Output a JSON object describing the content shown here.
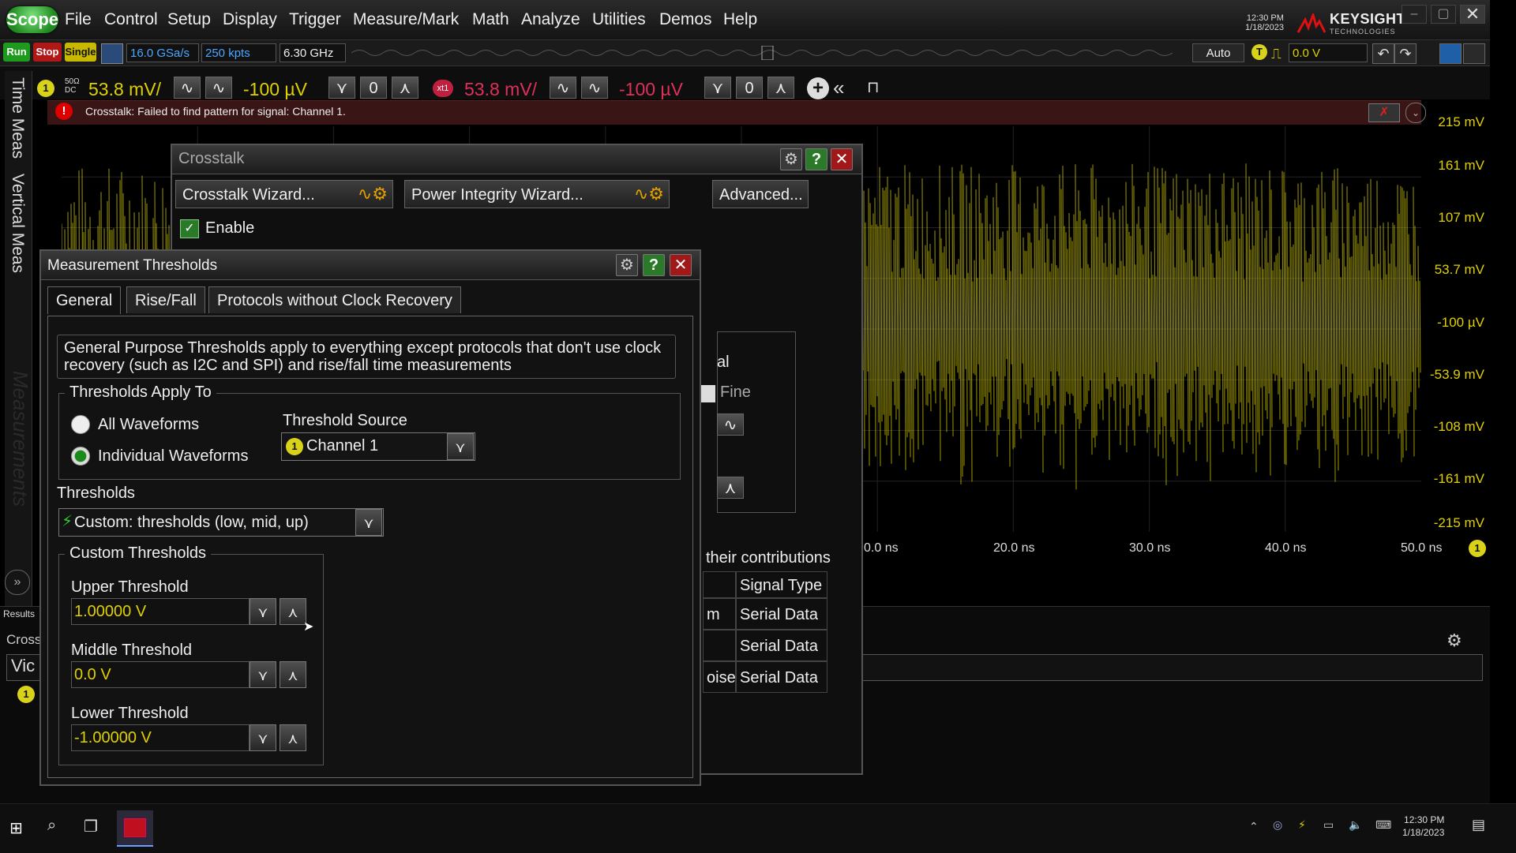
{
  "menubar": {
    "scope_label": "Scope",
    "items": [
      "File",
      "Control",
      "Setup",
      "Display",
      "Trigger",
      "Measure/Mark",
      "Math",
      "Analyze",
      "Utilities",
      "Demos",
      "Help"
    ],
    "clock_time": "12:30 PM",
    "clock_date": "1/18/2023",
    "brand": "KEYSIGHT",
    "brand_sub": "TECHNOLOGIES"
  },
  "toolbar": {
    "run": "Run",
    "stop": "Stop",
    "single": "Single",
    "sample_rate": "16.0 GSa/s",
    "memory": "250 kpts",
    "bandwidth": "6.30 GHz",
    "trigger_mode": "Auto",
    "trigger_badge": "T",
    "trigger_level": "0.0 V"
  },
  "channels": {
    "ch1_badge": "1",
    "ch1_coupling_top": "50Ω",
    "ch1_coupling_bottom": "DC",
    "ch1_scale": "53.8 mV/",
    "ch1_offset": "-100 µV",
    "x1_badge": "xt1",
    "x1_scale": "53.8 mV/",
    "x1_offset": "-100 µV"
  },
  "alert": {
    "message": "Crosstalk: Failed to find pattern for signal: Channel 1."
  },
  "sidetabs": {
    "time_meas": "Time Meas",
    "vertical_meas": "Vertical Meas",
    "measurements": "Measurements"
  },
  "waveform": {
    "y_labels": [
      "215 mV",
      "161 mV",
      "107 mV",
      "53.7 mV",
      "-100 µV",
      "-53.9 mV",
      "-108 mV",
      "-161 mV",
      "-215 mV"
    ],
    "x_labels": [
      "0.0 ns",
      "20.0 ns",
      "30.0 ns",
      "40.0 ns",
      "50.0 ns"
    ],
    "channel_marker": "1",
    "color": "#d4cc00"
  },
  "results": {
    "tab": "Results",
    "crosstalk_tab": "Cross",
    "victim_prefix": "Vic",
    "channel_marker": "1"
  },
  "crosstalk_dialog": {
    "title": "Crosstalk",
    "crosstalk_wizard": "Crosstalk Wizard...",
    "power_wizard": "Power Integrity Wizard...",
    "advanced": "Advanced...",
    "enable_label": "Enable",
    "partial_label": "al",
    "fine_label": "Fine",
    "contributions_label": "their contributions",
    "table_header": "Signal Type",
    "rows": [
      {
        "left": "m",
        "type": "Serial Data"
      },
      {
        "left": "",
        "type": "Serial Data"
      },
      {
        "left": "oise",
        "type": "Serial Data"
      }
    ]
  },
  "thresholds_dialog": {
    "title": "Measurement Thresholds",
    "tabs": [
      "General",
      "Rise/Fall",
      "Protocols without Clock Recovery"
    ],
    "description": "General Purpose Thresholds apply to everything except protocols that don't use clock recovery (such as I2C and SPI) and rise/fall time measurements",
    "apply_to_legend": "Thresholds Apply To",
    "all_waveforms": "All Waveforms",
    "individual_waveforms": "Individual Waveforms",
    "threshold_source_label": "Threshold Source",
    "threshold_source_badge": "1",
    "threshold_source_value": "Channel 1",
    "thresholds_label": "Thresholds",
    "thresholds_value": "Custom: thresholds (low, mid, up)",
    "custom_legend": "Custom Thresholds",
    "upper_label": "Upper Threshold",
    "upper_value": "1.00000 V",
    "middle_label": "Middle Threshold",
    "middle_value": "0.0 V",
    "lower_label": "Lower Threshold",
    "lower_value": "-1.00000 V"
  },
  "taskbar": {
    "time": "12:30 PM",
    "date": "1/18/2023"
  }
}
